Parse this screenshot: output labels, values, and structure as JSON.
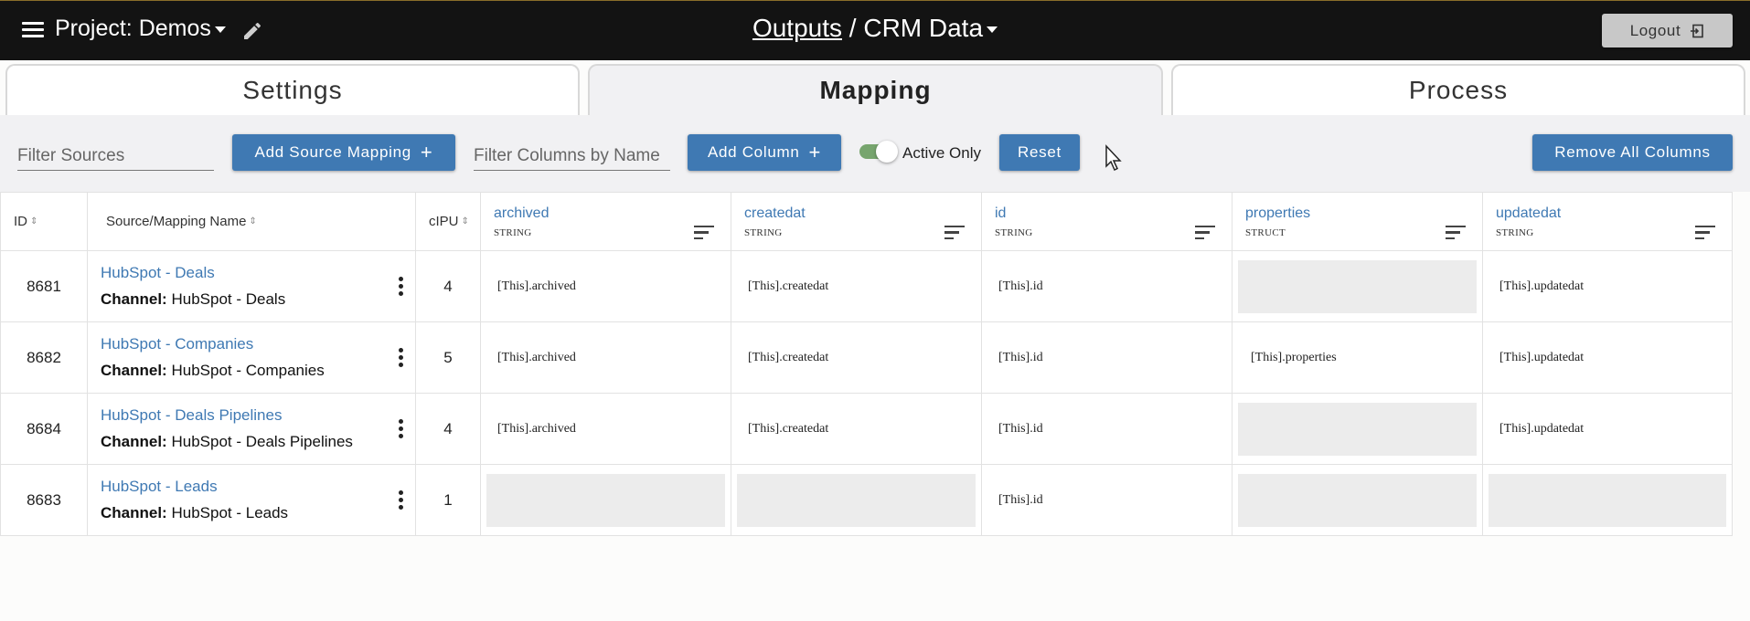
{
  "header": {
    "project_prefix": "Project:",
    "project_name": "Demos",
    "breadcrumb_link": "Outputs",
    "breadcrumb_sep": "/",
    "breadcrumb_current": "CRM Data",
    "logout_label": "Logout"
  },
  "tabs": [
    {
      "label": "Settings",
      "active": false
    },
    {
      "label": "Mapping",
      "active": true
    },
    {
      "label": "Process",
      "active": false
    }
  ],
  "toolbar": {
    "filter_sources_placeholder": "Filter Sources",
    "add_source_mapping_label": "Add Source Mapping",
    "filter_columns_placeholder": "Filter Columns by Name",
    "add_column_label": "Add Column",
    "active_only_label": "Active Only",
    "active_only_on": true,
    "reset_label": "Reset",
    "remove_all_label": "Remove All Columns"
  },
  "table": {
    "headers": {
      "id": "ID",
      "source": "Source/Mapping Name",
      "cipu": "cIPU"
    },
    "columns": [
      {
        "name": "archived",
        "type": "STRING"
      },
      {
        "name": "createdat",
        "type": "STRING"
      },
      {
        "name": "id",
        "type": "STRING"
      },
      {
        "name": "properties",
        "type": "STRUCT"
      },
      {
        "name": "updatedat",
        "type": "STRING"
      }
    ],
    "channel_prefix": "Channel:",
    "rows": [
      {
        "id": "8681",
        "name": "HubSpot - Deals",
        "channel": "HubSpot - Deals",
        "cipu": "4",
        "cells": [
          "[This].archived",
          "[This].createdat",
          "[This].id",
          "",
          "[This].updatedat"
        ]
      },
      {
        "id": "8682",
        "name": "HubSpot - Companies",
        "channel": "HubSpot - Companies",
        "cipu": "5",
        "cells": [
          "[This].archived",
          "[This].createdat",
          "[This].id",
          "[This].properties",
          "[This].updatedat"
        ]
      },
      {
        "id": "8684",
        "name": "HubSpot - Deals Pipelines",
        "channel": "HubSpot - Deals Pipelines",
        "cipu": "4",
        "cells": [
          "[This].archived",
          "[This].createdat",
          "[This].id",
          "",
          "[This].updatedat"
        ]
      },
      {
        "id": "8683",
        "name": "HubSpot - Leads",
        "channel": "HubSpot - Leads",
        "cipu": "1",
        "cells": [
          "",
          "",
          "[This].id",
          "",
          ""
        ]
      }
    ]
  },
  "colors": {
    "accent": "#3f79b3",
    "topbar": "#131313",
    "toggle_on": "#77a56e"
  }
}
